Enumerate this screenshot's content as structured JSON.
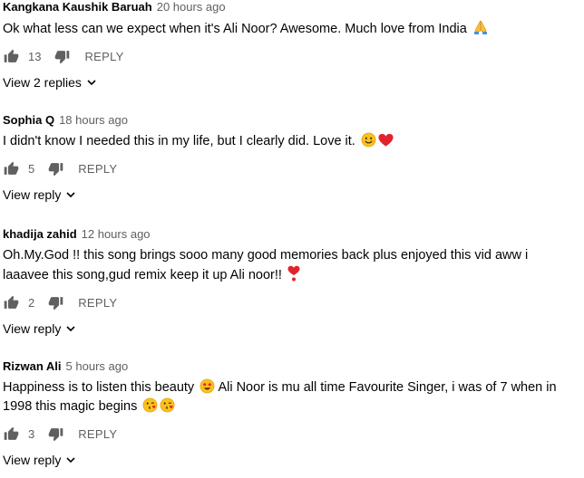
{
  "comments": [
    {
      "author": "Kangkana Kaushik Baruah",
      "time": "20 hours ago",
      "text": "Ok what less can we expect when it's Ali Noor? Awesome. Much love from India",
      "emojis": [
        "folded-hands"
      ],
      "likes": "13",
      "reply_label": "REPLY",
      "view_replies": "View 2 replies"
    },
    {
      "author": "Sophia Q",
      "time": "18 hours ago",
      "text": "I didn't know I needed this in my life, but I clearly did. Love it.",
      "emojis": [
        "smiling-face",
        "red-heart"
      ],
      "likes": "5",
      "reply_label": "REPLY",
      "view_replies": "View reply"
    },
    {
      "author": "khadija zahid",
      "time": "12 hours ago",
      "text": "Oh.My.God !! this song brings sooo many good memories back plus enjoyed this vid aww i laaavee this song,gud remix keep it up Ali noor!!",
      "emojis": [
        "heart-exclamation"
      ],
      "likes": "2",
      "reply_label": "REPLY",
      "view_replies": "View reply"
    },
    {
      "author": "Rizwan Ali",
      "time": "5 hours ago",
      "text_part1": "Happiness is to listen this beauty",
      "text_part2": "Ali Noor is mu all time Favourite Singer, i was of 7 when in 1998 this magic begins",
      "emojis": [
        "star-struck",
        "face-blowing-kiss",
        "face-blowing-kiss"
      ],
      "likes": "3",
      "reply_label": "REPLY",
      "view_replies": "View reply"
    }
  ],
  "icons": {
    "like": "thumbs-up-icon",
    "dislike": "thumbs-down-icon",
    "expand": "chevron-down-icon"
  },
  "colors": {
    "text": "#030303",
    "secondary": "#606060",
    "heart": "#e0242d"
  }
}
